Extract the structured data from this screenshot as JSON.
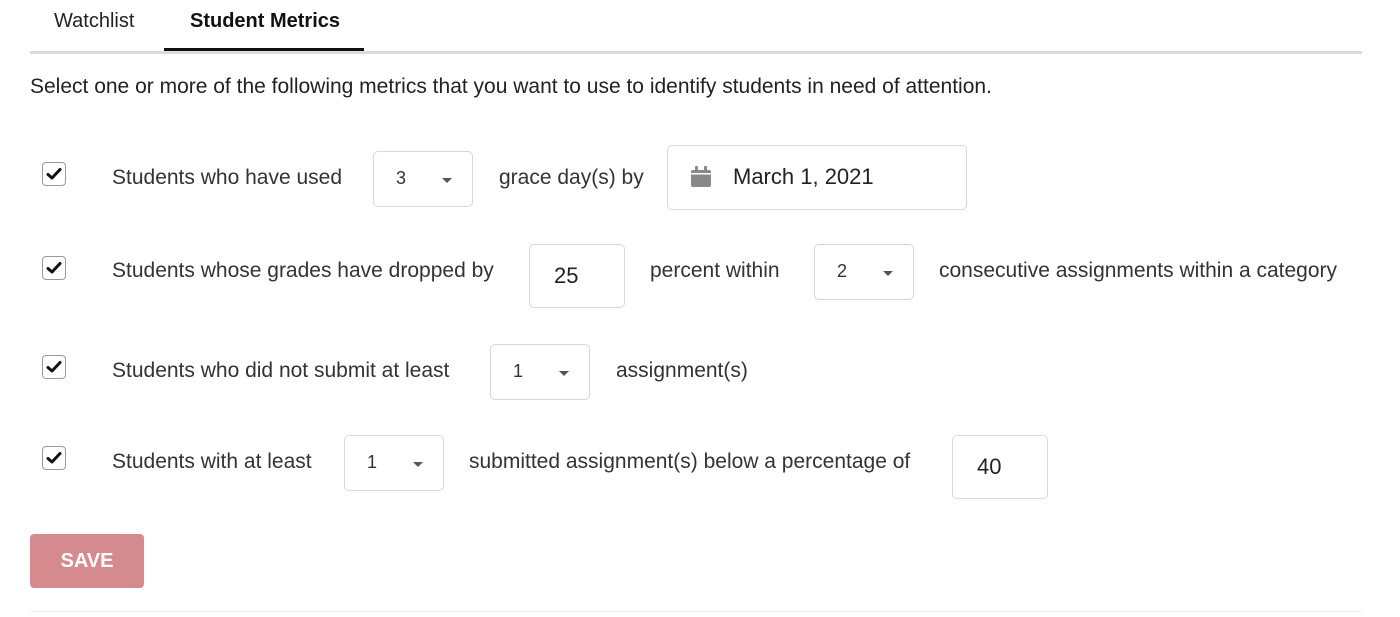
{
  "tabs": [
    {
      "label": "Watchlist",
      "active": false
    },
    {
      "label": "Student Metrics",
      "active": true
    }
  ],
  "intro": "Select one or more of the following metrics that you want to use to identify students in need of attention.",
  "metrics": {
    "grace_days": {
      "checked": true,
      "label_before": "Students who have used",
      "count_value": "3",
      "label_middle": "grace day(s) by",
      "date_value": "March 1, 2021",
      "date_icon": "calendar-icon"
    },
    "grade_drop": {
      "checked": true,
      "label_before": "Students whose grades have dropped by",
      "percent_value": "25",
      "label_middle": "percent within",
      "consecutive_value": "2",
      "label_after": "consecutive assignments within a category"
    },
    "missing_submissions": {
      "checked": true,
      "label_before": "Students who did not submit at least",
      "count_value": "1",
      "label_after": "assignment(s)"
    },
    "low_scores": {
      "checked": true,
      "label_before": "Students with at least",
      "count_value": "1",
      "label_middle": "submitted assignment(s) below a percentage of",
      "percent_value": "40"
    }
  },
  "save_button": {
    "label": "SAVE",
    "color": "#d58b8e"
  }
}
